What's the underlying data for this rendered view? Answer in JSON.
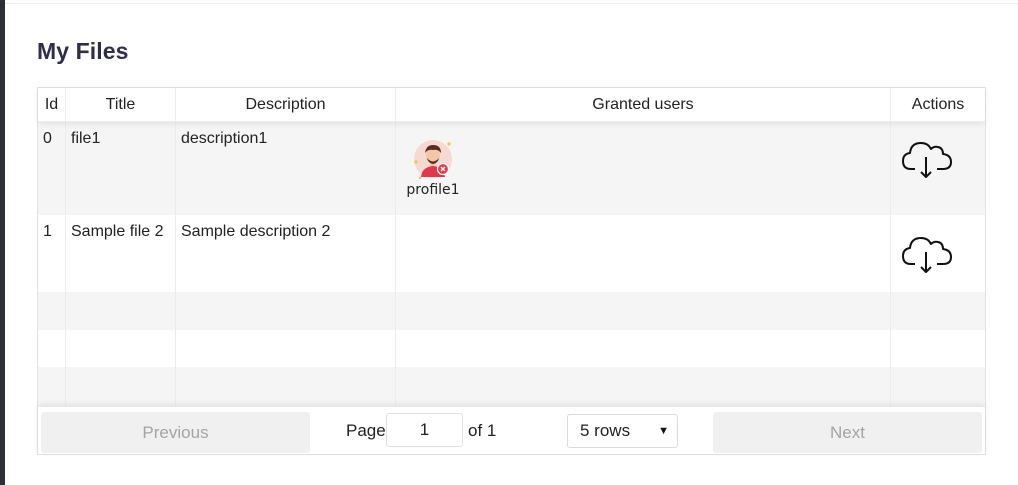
{
  "page": {
    "title": "My Files"
  },
  "table": {
    "columns": [
      "Id",
      "Title",
      "Description",
      "Granted users",
      "Actions"
    ],
    "rows": [
      {
        "id": "0",
        "title": "file1",
        "description": "description1",
        "granted_users": [
          "profile1"
        ],
        "action_icon": "cloud-download-icon"
      },
      {
        "id": "1",
        "title": "Sample file 2",
        "description": "Sample description 2",
        "granted_users": [],
        "action_icon": "cloud-download-icon"
      }
    ]
  },
  "pagination": {
    "previous_label": "Previous",
    "next_label": "Next",
    "page_label": "Page",
    "current_page": "1",
    "of_label": "of 1",
    "rows_selected": "5 rows"
  },
  "colors": {
    "title": "#2f2d4e",
    "stripe": "#f5f5f5",
    "rail": "#2b3036",
    "avatar_bg": "#f6d9d2",
    "badge": "#e53a4a"
  }
}
